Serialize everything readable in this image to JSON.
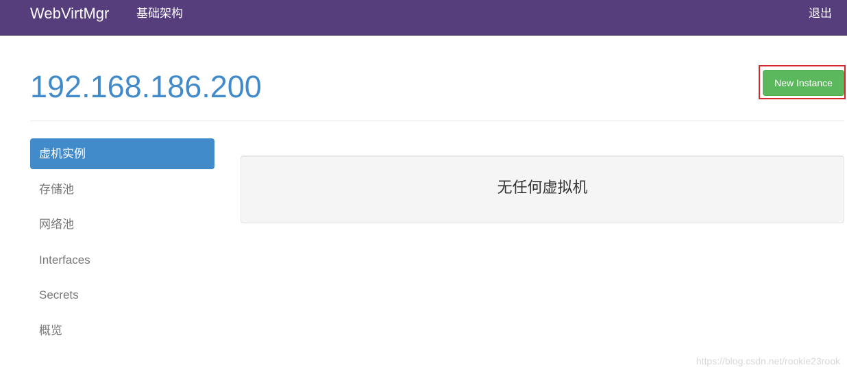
{
  "navbar": {
    "brand": "WebVirtMgr",
    "link": "基础架构",
    "logout": "退出",
    "bg_color": "#563d7c"
  },
  "header": {
    "title": "192.168.186.200",
    "new_instance_label": "New Instance"
  },
  "sidebar": {
    "items": [
      {
        "label": "虚机实例",
        "active": true
      },
      {
        "label": "存储池",
        "active": false
      },
      {
        "label": "网络池",
        "active": false
      },
      {
        "label": "Interfaces",
        "active": false
      },
      {
        "label": "Secrets",
        "active": false
      },
      {
        "label": "概览",
        "active": false
      }
    ]
  },
  "main": {
    "empty_message": "无任何虚拟机"
  },
  "watermark": "https://blog.csdn.net/rookie23rook",
  "colors": {
    "primary": "#428bca",
    "success": "#5cb85c",
    "highlight": "#d9262c"
  }
}
